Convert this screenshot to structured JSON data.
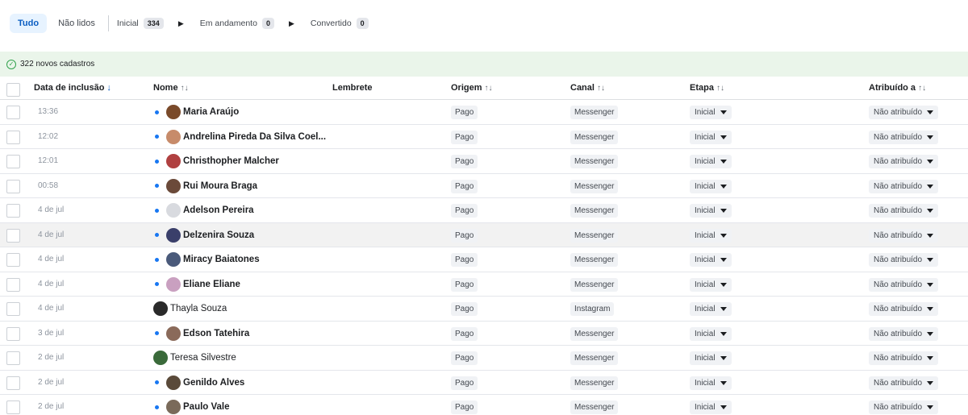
{
  "filters": {
    "all": "Tudo",
    "unread": "Não lidos",
    "stages": [
      {
        "label": "Inicial",
        "count": "334"
      },
      {
        "label": "Em andamento",
        "count": "0"
      },
      {
        "label": "Convertido",
        "count": "0"
      }
    ]
  },
  "banner": {
    "text": "322 novos cadastros"
  },
  "table": {
    "headers": {
      "date": "Data de inclusão",
      "name": "Nome",
      "reminder": "Lembrete",
      "origin": "Origem",
      "channel": "Canal",
      "stage": "Etapa",
      "assigned": "Atribuído a"
    },
    "sort_desc_icon": "↓",
    "sort_both_icon": "↑↓",
    "rows": [
      {
        "date": "13:36",
        "name": "Maria Araújo",
        "origin": "Pago",
        "channel": "Messenger",
        "stage": "Inicial",
        "assigned": "Não atribuído"
      },
      {
        "date": "12:02",
        "name": "Andrelina Pireda Da Silva Coel...",
        "origin": "Pago",
        "channel": "Messenger",
        "stage": "Inicial",
        "assigned": "Não atribuído"
      },
      {
        "date": "12:01",
        "name": "Christhopher Malcher",
        "origin": "Pago",
        "channel": "Messenger",
        "stage": "Inicial",
        "assigned": "Não atribuído"
      },
      {
        "date": "00:58",
        "name": "Rui Moura Braga",
        "origin": "Pago",
        "channel": "Messenger",
        "stage": "Inicial",
        "assigned": "Não atribuído"
      },
      {
        "date": "4 de jul",
        "name": "Adelson Pereira",
        "origin": "Pago",
        "channel": "Messenger",
        "stage": "Inicial",
        "assigned": "Não atribuído"
      },
      {
        "date": "4 de jul",
        "name": "Delzenira Souza",
        "origin": "Pago",
        "channel": "Messenger",
        "stage": "Inicial",
        "assigned": "Não atribuído"
      },
      {
        "date": "4 de jul",
        "name": "Miracy Baiatones",
        "origin": "Pago",
        "channel": "Messenger",
        "stage": "Inicial",
        "assigned": "Não atribuído"
      },
      {
        "date": "4 de jul",
        "name": "Eliane Eliane",
        "origin": "Pago",
        "channel": "Messenger",
        "stage": "Inicial",
        "assigned": "Não atribuído"
      },
      {
        "date": "4 de jul",
        "name": "Thayla Souza",
        "origin": "Pago",
        "channel": "Instagram",
        "stage": "Inicial",
        "assigned": "Não atribuído"
      },
      {
        "date": "3 de jul",
        "name": "Edson Tatehira",
        "origin": "Pago",
        "channel": "Messenger",
        "stage": "Inicial",
        "assigned": "Não atribuído"
      },
      {
        "date": "2 de jul",
        "name": "Teresa Silvestre",
        "origin": "Pago",
        "channel": "Messenger",
        "stage": "Inicial",
        "assigned": "Não atribuído"
      },
      {
        "date": "2 de jul",
        "name": "Genildo Alves",
        "origin": "Pago",
        "channel": "Messenger",
        "stage": "Inicial",
        "assigned": "Não atribuído"
      },
      {
        "date": "2 de jul",
        "name": "Paulo Vale",
        "origin": "Pago",
        "channel": "Messenger",
        "stage": "Inicial",
        "assigned": "Não atribuído"
      }
    ]
  }
}
